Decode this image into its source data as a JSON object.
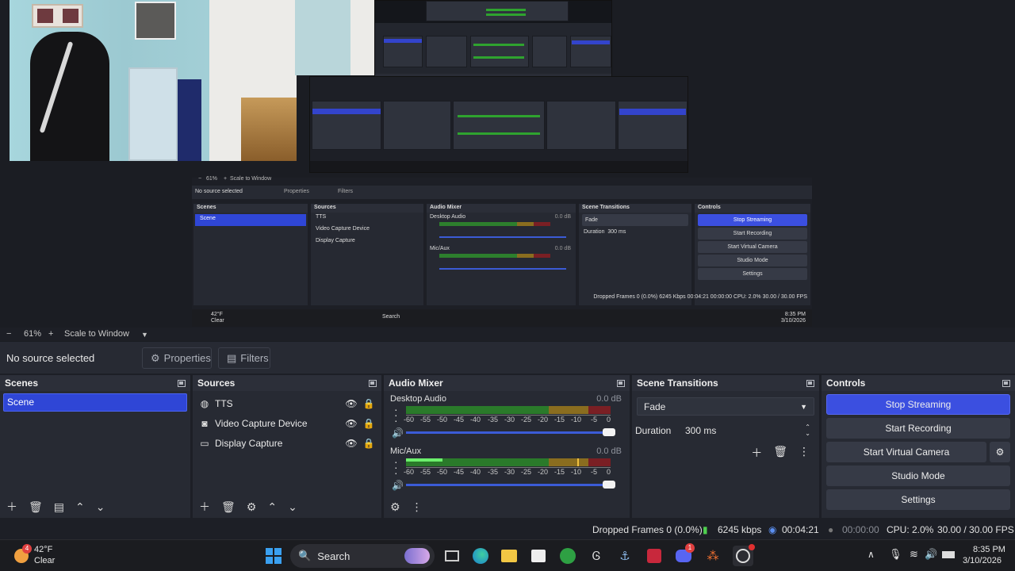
{
  "zoom": {
    "minus": "−",
    "value": "61%",
    "plus": "+",
    "mode": "Scale to Window"
  },
  "context": {
    "no_source": "No source selected",
    "properties": "Properties",
    "filters": "Filters"
  },
  "scenes": {
    "title": "Scenes",
    "items": [
      "Scene"
    ]
  },
  "sources": {
    "title": "Sources",
    "items": [
      {
        "label": "TTS",
        "icon": "globe-icon"
      },
      {
        "label": "Video Capture Device",
        "icon": "camera-icon"
      },
      {
        "label": "Display Capture",
        "icon": "monitor-icon"
      }
    ]
  },
  "mixer": {
    "title": "Audio Mixer",
    "channels": [
      {
        "name": "Desktop Audio",
        "db": "0.0 dB",
        "level": 0
      },
      {
        "name": "Mic/Aux",
        "db": "0.0 dB",
        "level": 0.18
      }
    ],
    "ticks": [
      "-60",
      "-55",
      "-50",
      "-45",
      "-40",
      "-35",
      "-30",
      "-25",
      "-20",
      "-15",
      "-10",
      "-5",
      "0"
    ]
  },
  "transitions": {
    "title": "Scene Transitions",
    "selected": "Fade",
    "duration_label": "Duration",
    "duration_value": "300 ms"
  },
  "controls": {
    "title": "Controls",
    "buttons": [
      "Stop Streaming",
      "Start Recording",
      "Start Virtual Camera",
      "Studio Mode",
      "Settings"
    ]
  },
  "status": {
    "dropped": "Dropped Frames 0 (0.0%)",
    "bitrate": "6245 kbps",
    "stream_time": "00:04:21",
    "rec_time": "00:00:00",
    "cpu": "CPU: 2.0%",
    "fps": "30.00 / 30.00 FPS"
  },
  "taskbar": {
    "temp": "42°F",
    "weather": "Clear",
    "weather_badge": "4",
    "search": "Search",
    "time": "8:35 PM",
    "date": "3/10/2026",
    "discord_badge": "1"
  },
  "mini": {
    "zoom": "61%",
    "zoom_mode": "Scale to Window",
    "no_source": "No source selected",
    "properties": "Properties",
    "filters": "Filters",
    "scenes": "Scenes",
    "scene": "Scene",
    "sources": "Sources",
    "src1": "TTS",
    "src2": "Video Capture Device",
    "src3": "Display Capture",
    "mixer": "Audio Mixer",
    "desktop": "Desktop Audio",
    "mic": "Mic/Aux",
    "db": "0.0 dB",
    "transitions": "Scene Transitions",
    "fade": "Fade",
    "duration": "Duration",
    "dur_val": "300 ms",
    "controls": "Controls",
    "b1": "Stop Streaming",
    "b2": "Start Recording",
    "b3": "Start Virtual Camera",
    "b4": "Studio Mode",
    "b5": "Settings",
    "status": "Dropped Frames 0 (0.0%)   6245 Kbps   00:04:21   00:00:00   CPU: 2.0%   30.00 / 30.00 FPS",
    "temp": "42°F",
    "weather": "Clear",
    "search": "Search",
    "time": "8:35 PM",
    "date": "3/10/2026"
  }
}
